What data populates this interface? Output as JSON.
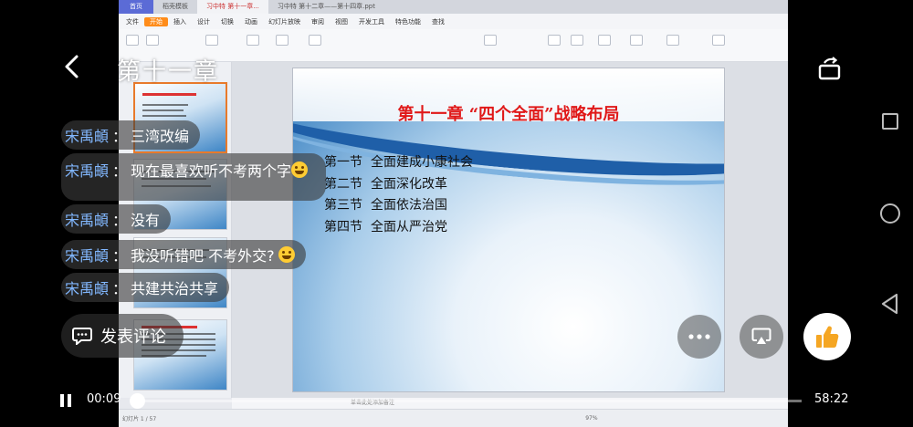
{
  "player": {
    "title": "第十一章",
    "comment_label": "发表评论",
    "time_current": "00:09",
    "time_total": "58:22",
    "progress": 0.0026
  },
  "chat": [
    {
      "name": "宋禹頔",
      "sep": "：",
      "msg": "三湾改编",
      "emoji": false
    },
    {
      "name": "宋禹頔",
      "sep": "：",
      "msg": "现在最喜欢听不考两个字",
      "emoji": true
    },
    {
      "name": "宋禹頔",
      "sep": "：",
      "msg": "没有",
      "emoji": false
    },
    {
      "name": "宋禹頔",
      "sep": "：",
      "msg": "我没听错吧 不考外交?",
      "emoji": true
    },
    {
      "name": "宋禹頔",
      "sep": "：",
      "msg": "共建共治共享",
      "emoji": false
    }
  ],
  "wps": {
    "tabs": [
      "首页",
      "稻壳模板",
      "习中特 第十一章...",
      "习中特 第十二章——第十四章.ppt"
    ],
    "menus": [
      "文件",
      "开始",
      "插入",
      "设计",
      "切换",
      "动画",
      "幻灯片放映",
      "审阅",
      "视图",
      "开发工具",
      "特色功能",
      "查找"
    ],
    "active_menu": "开始",
    "slide_counter": "幻灯片 1 / 57",
    "notes_hint": "单击此处添加备注",
    "zoom": "97%"
  },
  "slide": {
    "title": "第十一章 “四个全面”战略布局",
    "sections": [
      {
        "num": "第一节",
        "text": "全面建成小康社会"
      },
      {
        "num": "第二节",
        "text": "全面深化改革"
      },
      {
        "num": "第三节",
        "text": "全面依法治国"
      },
      {
        "num": "第四节",
        "text": "全面从严治党"
      }
    ]
  },
  "colors": {
    "chat_name": "#82b8ff",
    "slide_title": "#e01818",
    "menu_active": "#ff8c1a",
    "like_icon": "#f5a623"
  },
  "icons": [
    "back-arrow-icon",
    "rotate-icon",
    "comment-icon",
    "more-icon",
    "cast-icon",
    "thumbs-up-icon",
    "pause-icon"
  ]
}
